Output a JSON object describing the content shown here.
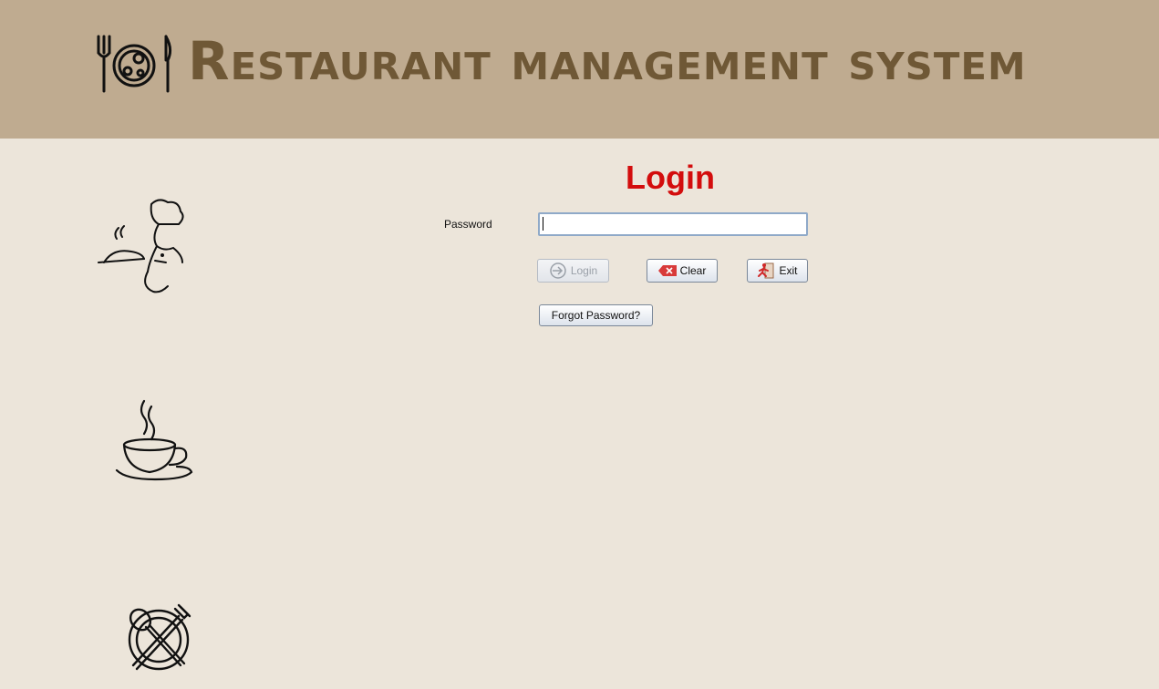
{
  "header": {
    "title": "Restaurant management system"
  },
  "login": {
    "title": "Login",
    "password_label": "Password",
    "password_value": "",
    "login_button": "Login",
    "clear_button": "Clear",
    "exit_button": "Exit",
    "forgot_button": "Forgot Password?"
  },
  "icons": {
    "logo": "fork-plate-knife-icon",
    "chef": "chef-waiter-icon",
    "cup": "coffee-cup-icon",
    "plate": "spoon-fork-plate-icon"
  },
  "colors": {
    "header_bg": "#bfab90",
    "page_bg": "#ece5da",
    "title_text": "#6f5836",
    "login_title": "#d30d0d"
  }
}
